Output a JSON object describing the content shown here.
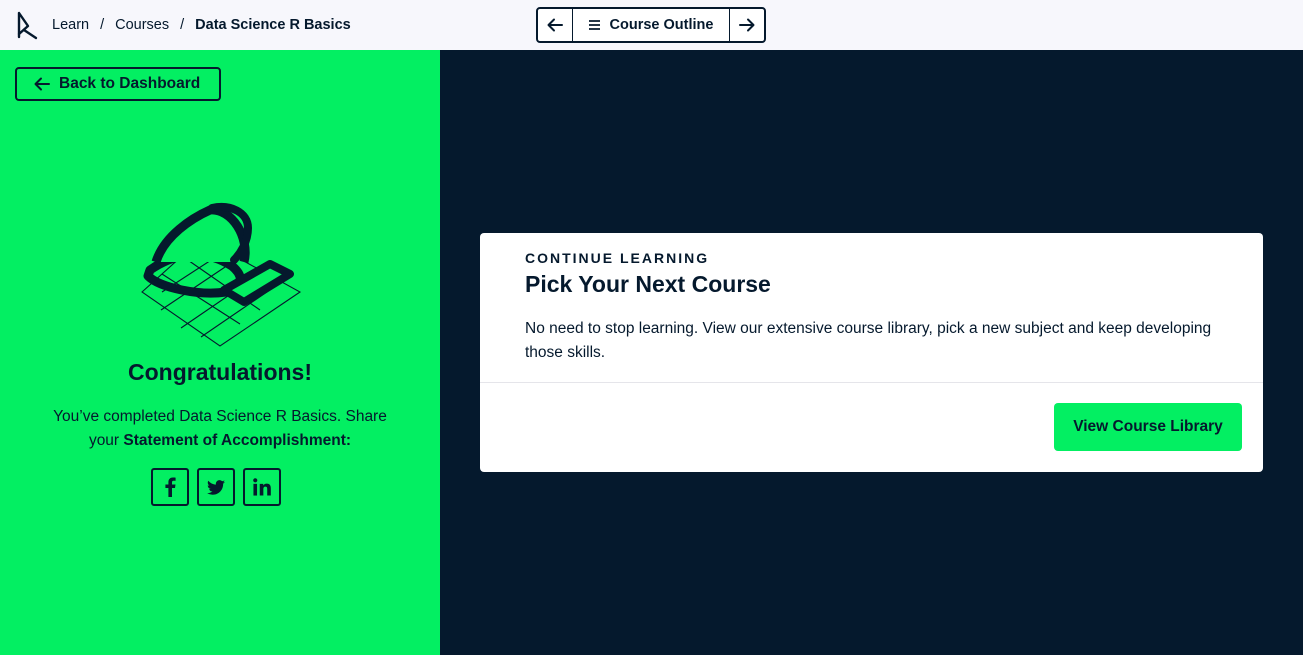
{
  "breadcrumb": {
    "items": [
      "Learn",
      "Courses"
    ],
    "separator": "/",
    "current": "Data Science R Basics"
  },
  "course_nav": {
    "prev_icon": "arrow-left-icon",
    "outline_label": "Course Outline",
    "next_icon": "arrow-right-icon"
  },
  "left_panel": {
    "back_label": "Back to Dashboard",
    "congrats": "Congratulations!",
    "completed_text": "You’ve completed Data Science R Basics. Share your",
    "statement_label": "Statement of Accomplishment:",
    "share_icons": [
      "facebook-icon",
      "twitter-icon",
      "linkedin-icon"
    ]
  },
  "card": {
    "eyebrow": "CONTINUE LEARNING",
    "title": "Pick Your Next Course",
    "description": "No need to stop learning. View our extensive course library, pick a new subject and keep developing those skills.",
    "button_label": "View Course Library"
  },
  "colors": {
    "brand_green": "#03ef62",
    "navy": "#05192d",
    "topbar_bg": "#f7f7fc",
    "card_bg": "#ffffff"
  }
}
